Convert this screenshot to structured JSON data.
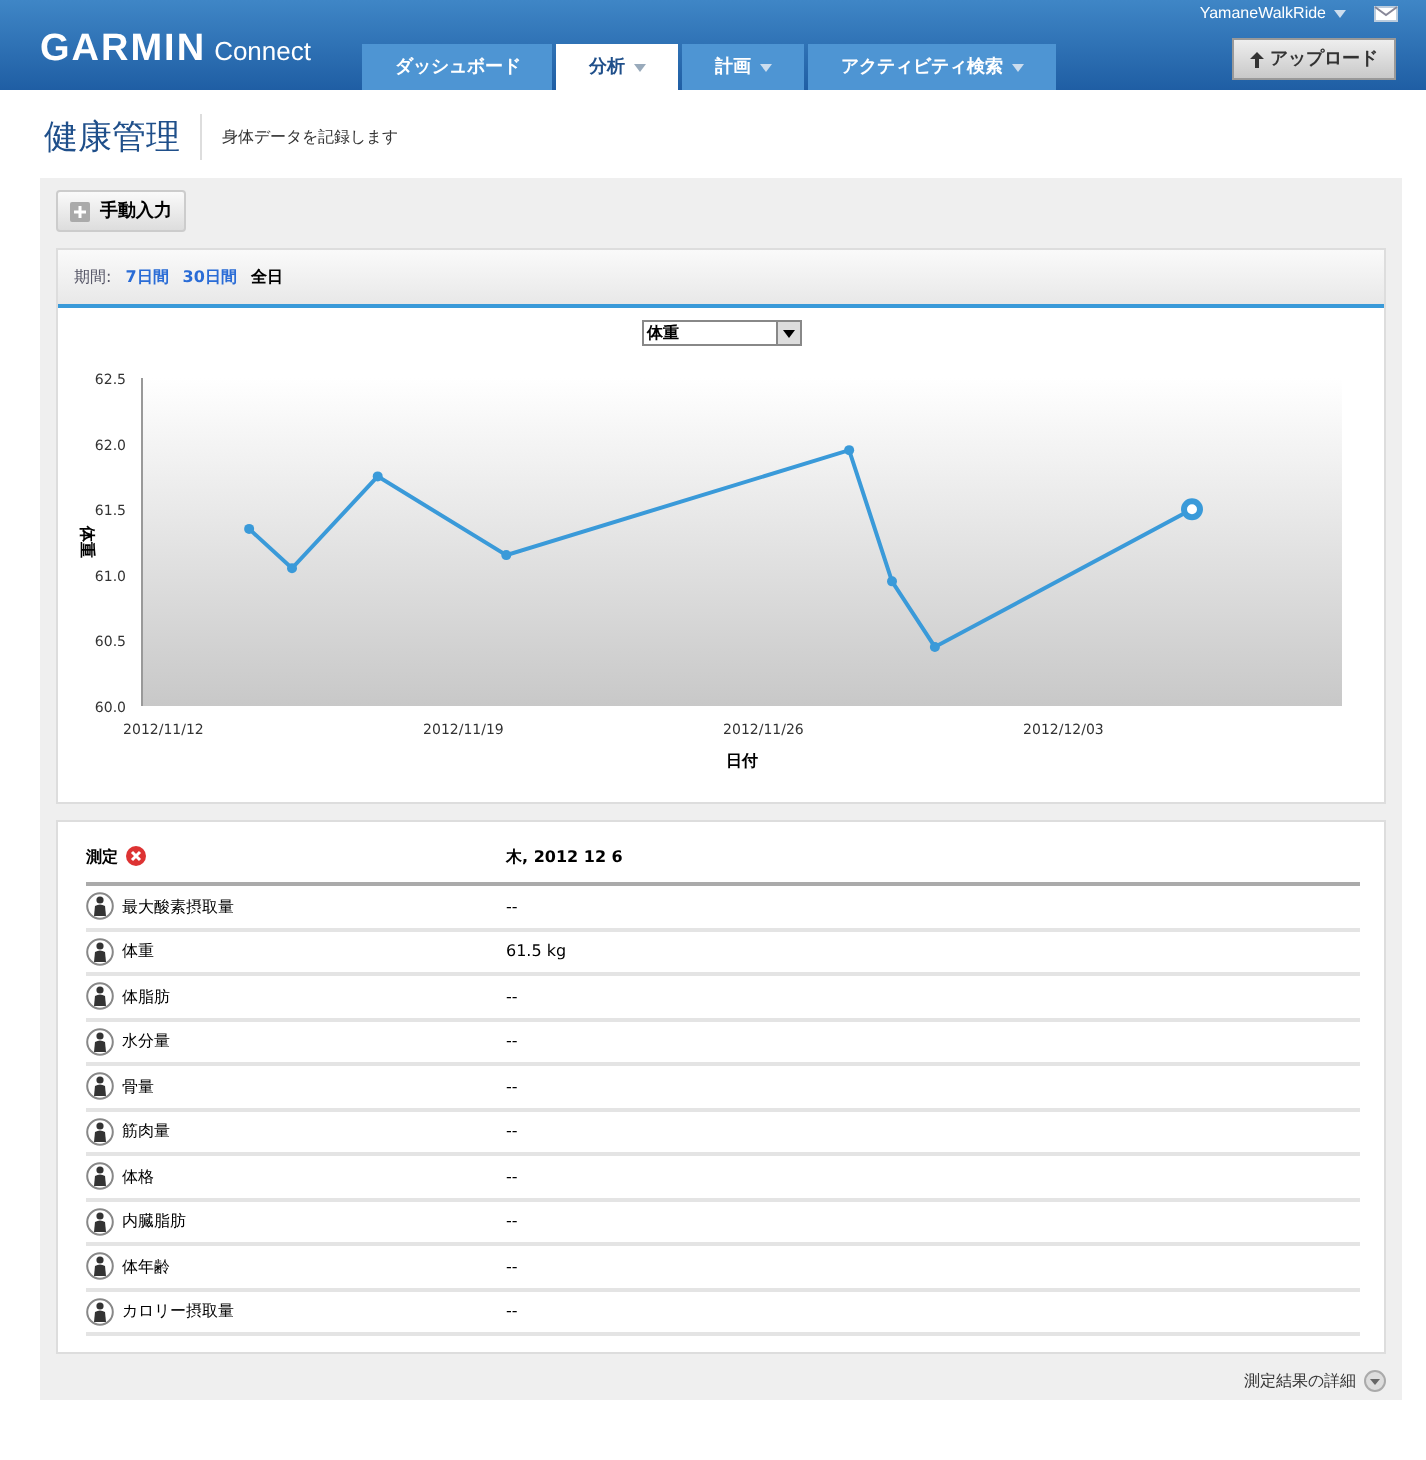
{
  "header": {
    "logo": "GARMIN",
    "logo_suffix": "Connect",
    "user": "YamaneWalkRide",
    "nav": [
      {
        "label": "ダッシュボード",
        "selected": false,
        "dropdown": false
      },
      {
        "label": "分析",
        "selected": true,
        "dropdown": true
      },
      {
        "label": "計画",
        "selected": false,
        "dropdown": true
      },
      {
        "label": "アクティビティ検索",
        "selected": false,
        "dropdown": true
      }
    ],
    "upload": "アップロード"
  },
  "page": {
    "title": "健康管理",
    "subtitle": "身体データを記録します"
  },
  "manual_entry": "手動入力",
  "period": {
    "label": "期間:",
    "options": [
      {
        "label": "7日間",
        "selected": false
      },
      {
        "label": "30日間",
        "selected": false
      },
      {
        "label": "全日",
        "selected": true
      }
    ]
  },
  "metric_select": {
    "value": "体重"
  },
  "chart": {
    "chart_data": {
      "type": "line",
      "marker": "circle",
      "xlabel": "日付",
      "ylabel": "体重",
      "categories": [
        "2012/11/12",
        null,
        null,
        null,
        null,
        null,
        null,
        "2012/11/19",
        null,
        null,
        null,
        null,
        null,
        null,
        "2012/11/26",
        null,
        null,
        null,
        null,
        null,
        null,
        "2012/12/03",
        null,
        null,
        null,
        null,
        null,
        null
      ],
      "values": [
        null,
        null,
        61.35,
        61.05,
        null,
        61.75,
        null,
        null,
        61.15,
        null,
        null,
        null,
        null,
        null,
        null,
        null,
        61.95,
        60.95,
        60.45,
        null,
        null,
        null,
        null,
        null,
        61.5,
        null,
        null,
        null
      ],
      "ylim": [
        60,
        62.5
      ],
      "yticks": [
        {
          "value": 60,
          "label": "60.0"
        },
        {
          "value": 60.5,
          "label": "60.5"
        },
        {
          "value": 61,
          "label": "61.0"
        },
        {
          "value": 61.5,
          "label": "61.5"
        },
        {
          "value": 62,
          "label": "62.0"
        },
        {
          "value": 62.5,
          "label": "62.5"
        }
      ]
    }
  },
  "table": {
    "columns": [
      "測定",
      "木, 2012 12 6"
    ],
    "rows": [
      {
        "name": "最大酸素摂取量",
        "value": "--"
      },
      {
        "name": "体重",
        "value": "61.5 kg"
      },
      {
        "name": "体脂肪",
        "value": "--"
      },
      {
        "name": "水分量",
        "value": "--"
      },
      {
        "name": "骨量",
        "value": "--"
      },
      {
        "name": "筋肉量",
        "value": "--"
      },
      {
        "name": "体格",
        "value": "--"
      },
      {
        "name": "内臓脂肪",
        "value": "--"
      },
      {
        "name": "体年齢",
        "value": "--"
      },
      {
        "name": "カロリー摂取量",
        "value": "--"
      }
    ]
  },
  "details_link": "測定結果の詳細"
}
